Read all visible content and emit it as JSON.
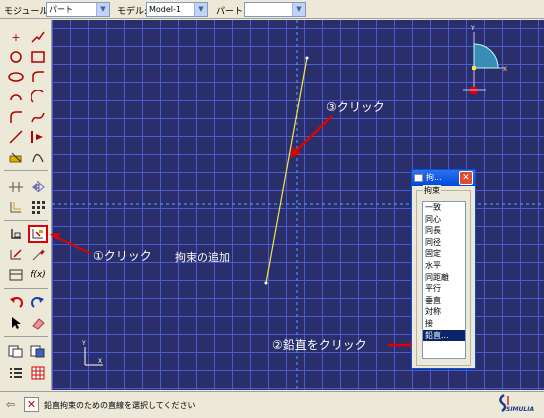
{
  "context_bar": {
    "module_label": "モジュール:",
    "module_value": "パート",
    "model_label": "モデル:",
    "model_value": "Model-1",
    "part_label": "パート:",
    "part_value": ""
  },
  "triad": {
    "x_label": "X",
    "y_label": "Y"
  },
  "viewport_axes": {
    "x_label": "X",
    "y_label": "Y"
  },
  "dialog": {
    "title": "拘...",
    "group_label": "拘束",
    "items": [
      "一致",
      "同心",
      "同長",
      "同径",
      "固定",
      "水平",
      "同距離",
      "平行",
      "垂直",
      "対称",
      "接",
      "鉛直..."
    ],
    "selected_index": 11
  },
  "annotations": {
    "step1": "①クリック",
    "step1_sub": "拘束の追加",
    "step2": "②鉛直をクリック",
    "step3": "③クリック"
  },
  "prompt": {
    "text": "鉛直拘束のための直線を選択してください"
  },
  "colors": {
    "viewport_bg": "#2a2f6b",
    "grid": "#4a5bd0",
    "sketch_line": "#f5e642",
    "annotation_arrow": "#e00000",
    "dialog_selection": "#0a246a"
  }
}
